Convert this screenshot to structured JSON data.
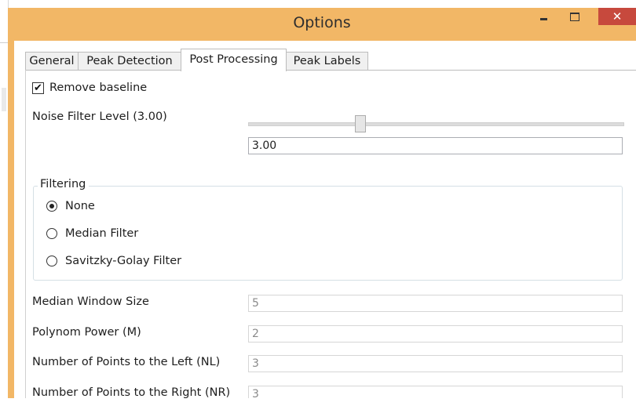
{
  "window": {
    "title": "Options",
    "minimize_label": "_",
    "maximize_label": "□",
    "close_label": "✕"
  },
  "tabs": [
    {
      "label": "General",
      "active": false
    },
    {
      "label": "Peak Detection",
      "active": false
    },
    {
      "label": "Post Processing",
      "active": true
    },
    {
      "label": "Peak Labels",
      "active": false
    }
  ],
  "post_processing": {
    "remove_baseline": {
      "label": "Remove baseline",
      "checked": true
    },
    "noise_filter": {
      "label": "Noise Filter Level (3.00)",
      "value": "3.00",
      "slider_fraction": 0.29
    },
    "filtering": {
      "title": "Filtering",
      "options": [
        {
          "label": "None",
          "selected": true
        },
        {
          "label": "Median Filter",
          "selected": false
        },
        {
          "label": "Savitzky-Golay Filter",
          "selected": false
        }
      ]
    },
    "fields": [
      {
        "label": "Median Window Size",
        "value": "5"
      },
      {
        "label": "Polynom Power (M)",
        "value": "2"
      },
      {
        "label": "Number of Points to the Left (NL)",
        "value": "3"
      },
      {
        "label": "Number of Points to the Right (NR)",
        "value": "3"
      }
    ]
  },
  "colors": {
    "titlebar": "#f2b766",
    "close_button": "#c7493d"
  }
}
